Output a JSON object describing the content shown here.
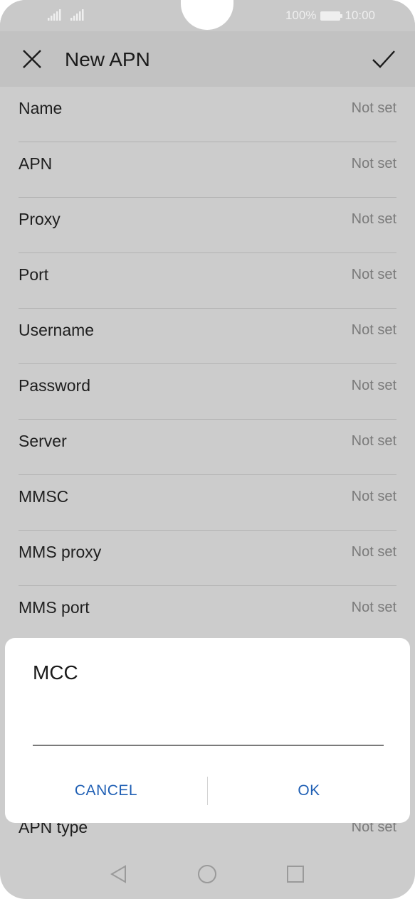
{
  "status": {
    "battery": "100%",
    "time": "10:00"
  },
  "appbar": {
    "title": "New APN",
    "close_icon": "close-icon",
    "confirm_icon": "check-icon"
  },
  "fields": [
    {
      "label": "Name",
      "value": "Not set"
    },
    {
      "label": "APN",
      "value": "Not set"
    },
    {
      "label": "Proxy",
      "value": "Not set"
    },
    {
      "label": "Port",
      "value": "Not set"
    },
    {
      "label": "Username",
      "value": "Not set"
    },
    {
      "label": "Password",
      "value": "Not set"
    },
    {
      "label": "Server",
      "value": "Not set"
    },
    {
      "label": "MMSC",
      "value": "Not set"
    },
    {
      "label": "MMS proxy",
      "value": "Not set"
    },
    {
      "label": "MMS port",
      "value": "Not set"
    }
  ],
  "partial_field": {
    "label": "APN type",
    "value": "Not set"
  },
  "dialog": {
    "title": "MCC",
    "input_value": "",
    "cancel": "CANCEL",
    "ok": "OK"
  },
  "colors": {
    "accent": "#1f5fb4",
    "scrim": "#cccccc"
  }
}
